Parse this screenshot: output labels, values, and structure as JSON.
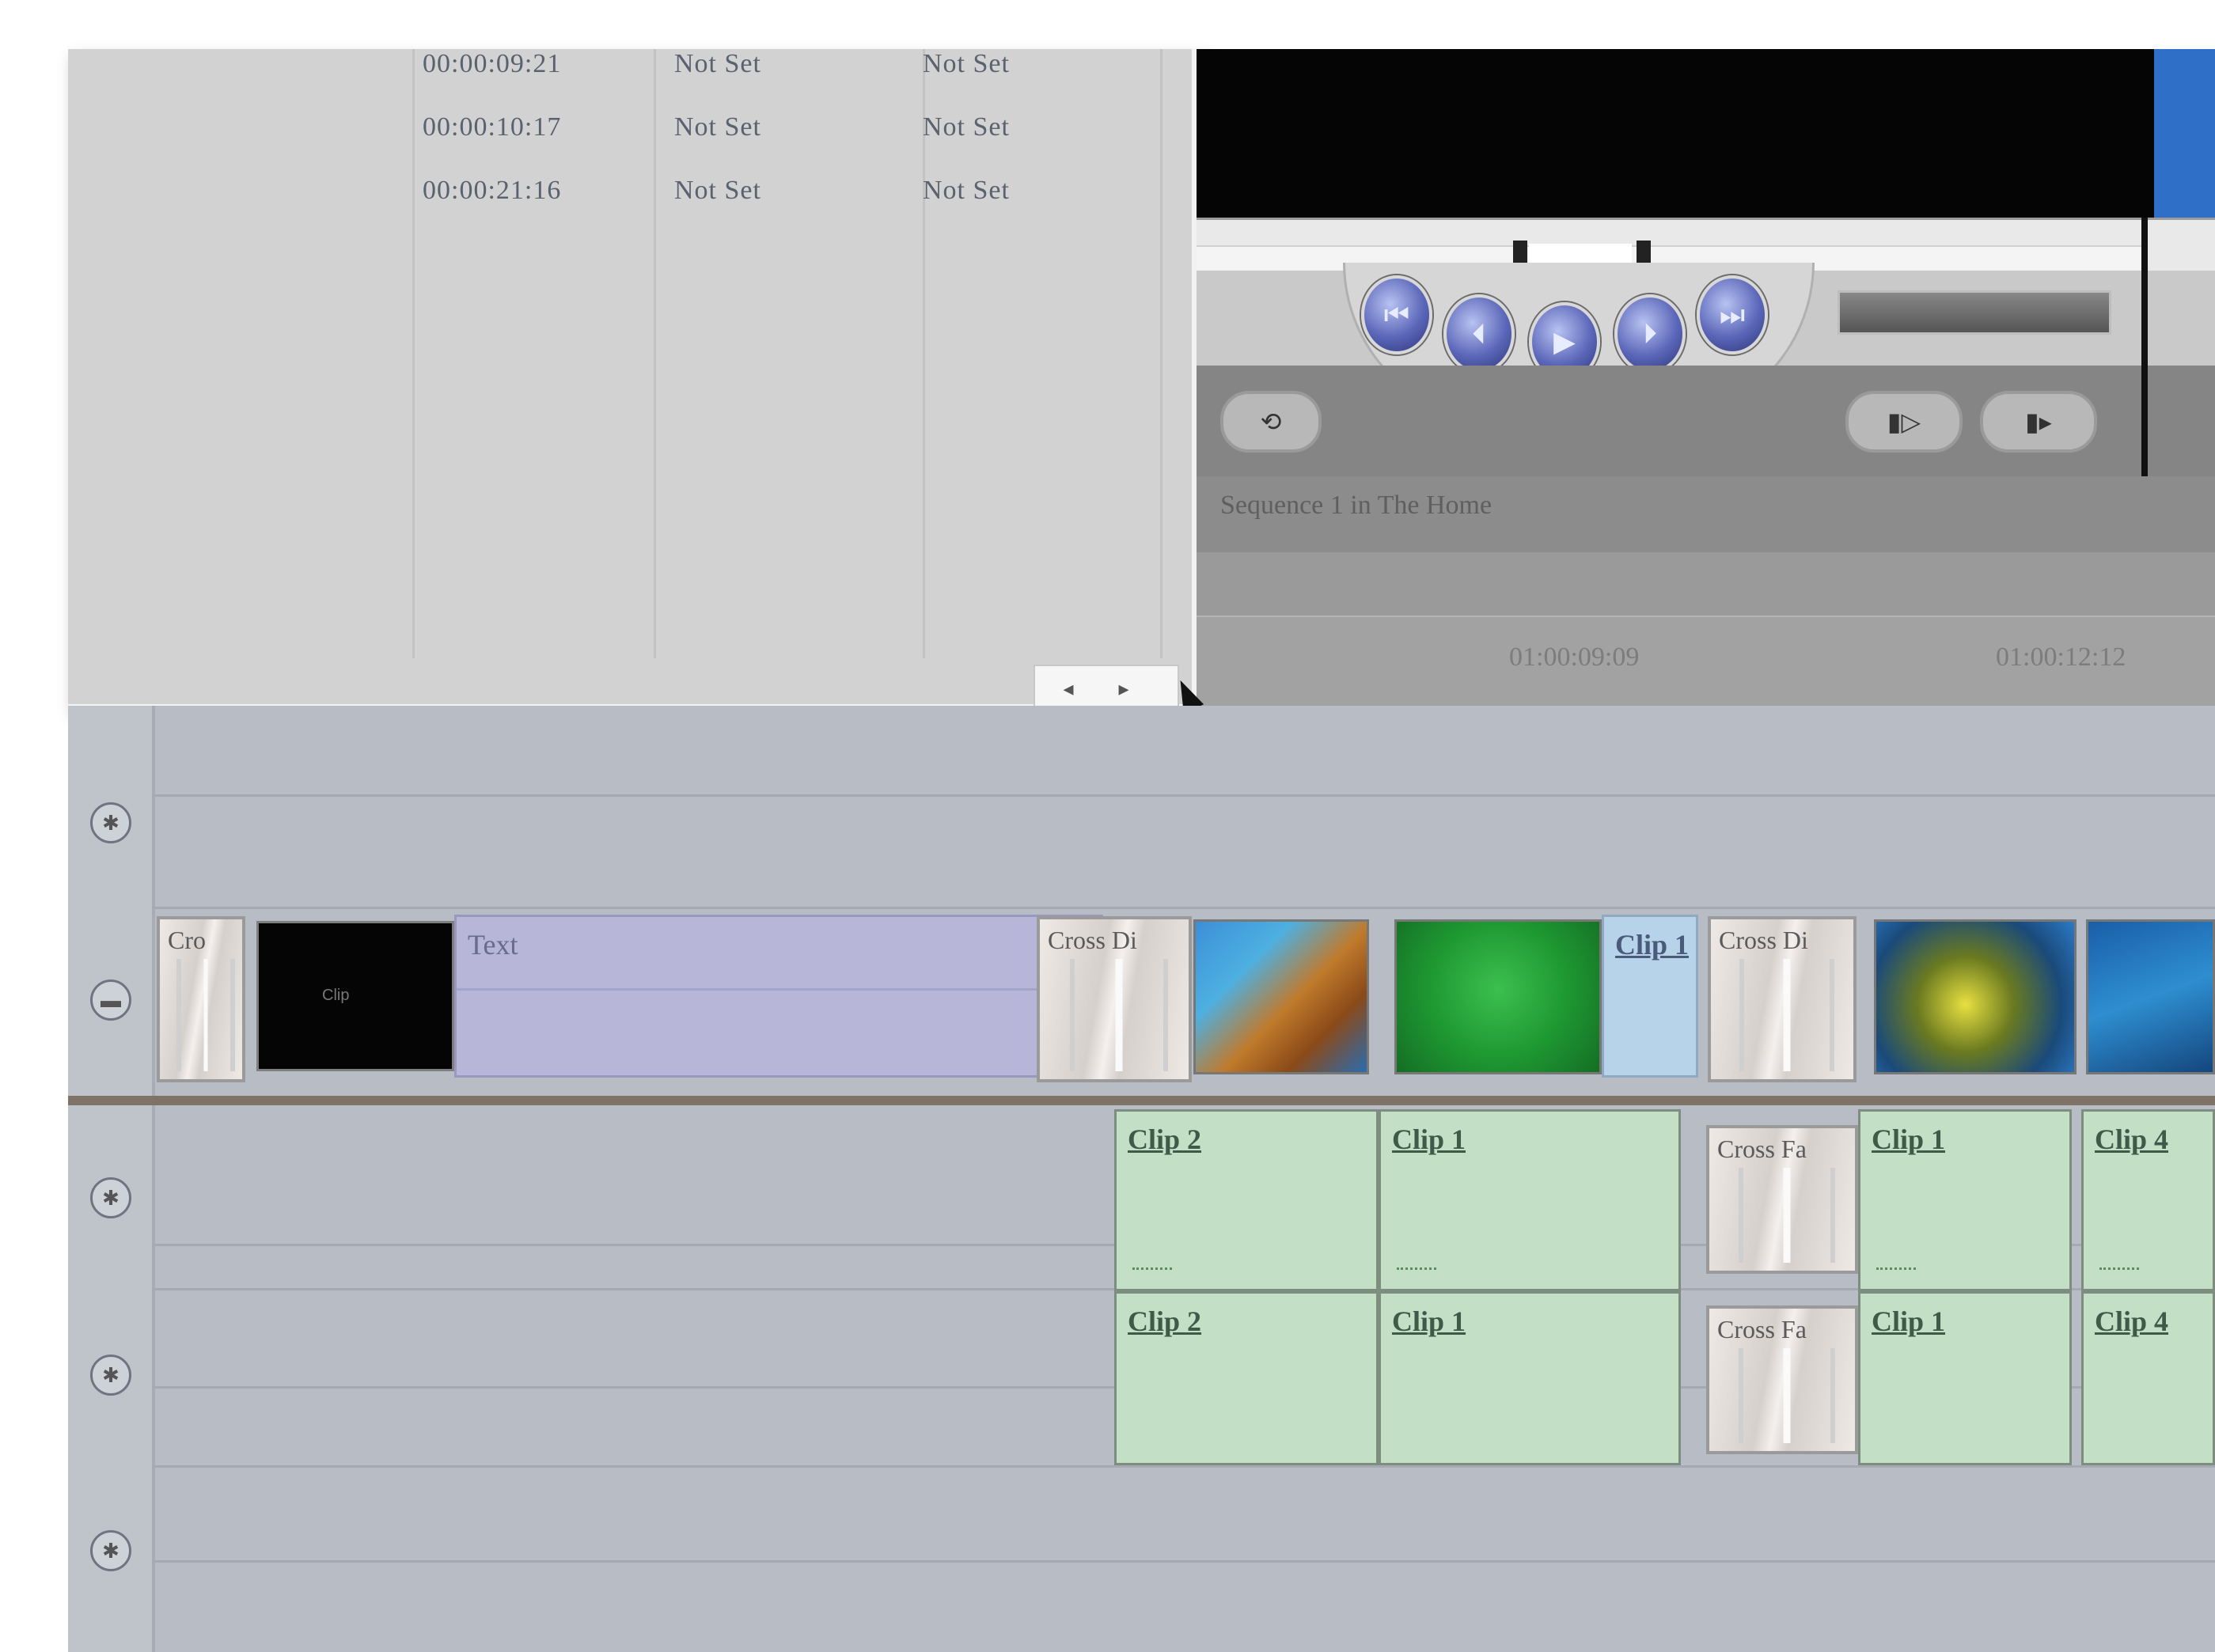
{
  "browser": {
    "rows": [
      {
        "timecode": "00:00:09:21",
        "in": "Not Set",
        "out": "Not Set"
      },
      {
        "timecode": "00:00:10:17",
        "in": "Not Set",
        "out": "Not Set"
      },
      {
        "timecode": "00:00:21:16",
        "in": "Not Set",
        "out": "Not Set"
      }
    ],
    "scroll_left": "◂",
    "scroll_right": "▸"
  },
  "canvas": {
    "status_text": "Sequence 1 in The Home",
    "timecode_center": "01:00:09:09",
    "timecode_right": "01:00:12:12",
    "transport": [
      "⏮",
      "⏴",
      "▶",
      "⏵",
      "⏭"
    ],
    "buttons": {
      "left": "⟲",
      "mark_in": "▮▷",
      "mark_out": "▮▸"
    }
  },
  "timeline": {
    "track_icons": [
      "lock-icon",
      "lock-icon",
      "lock-icon",
      "lock-icon",
      "lock-icon"
    ],
    "video_clips": [
      {
        "label": "Cro",
        "kind": "transition"
      },
      {
        "label": "Clip",
        "kind": "black"
      },
      {
        "label": "Text",
        "kind": "generator"
      },
      {
        "label": "Cross Di",
        "kind": "transition"
      },
      {
        "label": "Clip 1",
        "kind": "video"
      },
      {
        "label": "Cross Di",
        "kind": "transition"
      }
    ],
    "audio_a1": [
      "Clip 2",
      "Clip 1",
      "Cross Fa",
      "Clip 1",
      "Clip 4"
    ],
    "audio_a2": [
      "Clip 2",
      "Clip 1",
      "Cross Fa",
      "Clip 1",
      "Clip 4"
    ]
  },
  "colors": {
    "generator": "#b7b6d8",
    "video_clip": "#b7d3ea",
    "audio_clip": "#c3e0c7",
    "timeline_bg": "#b7bcc5"
  }
}
